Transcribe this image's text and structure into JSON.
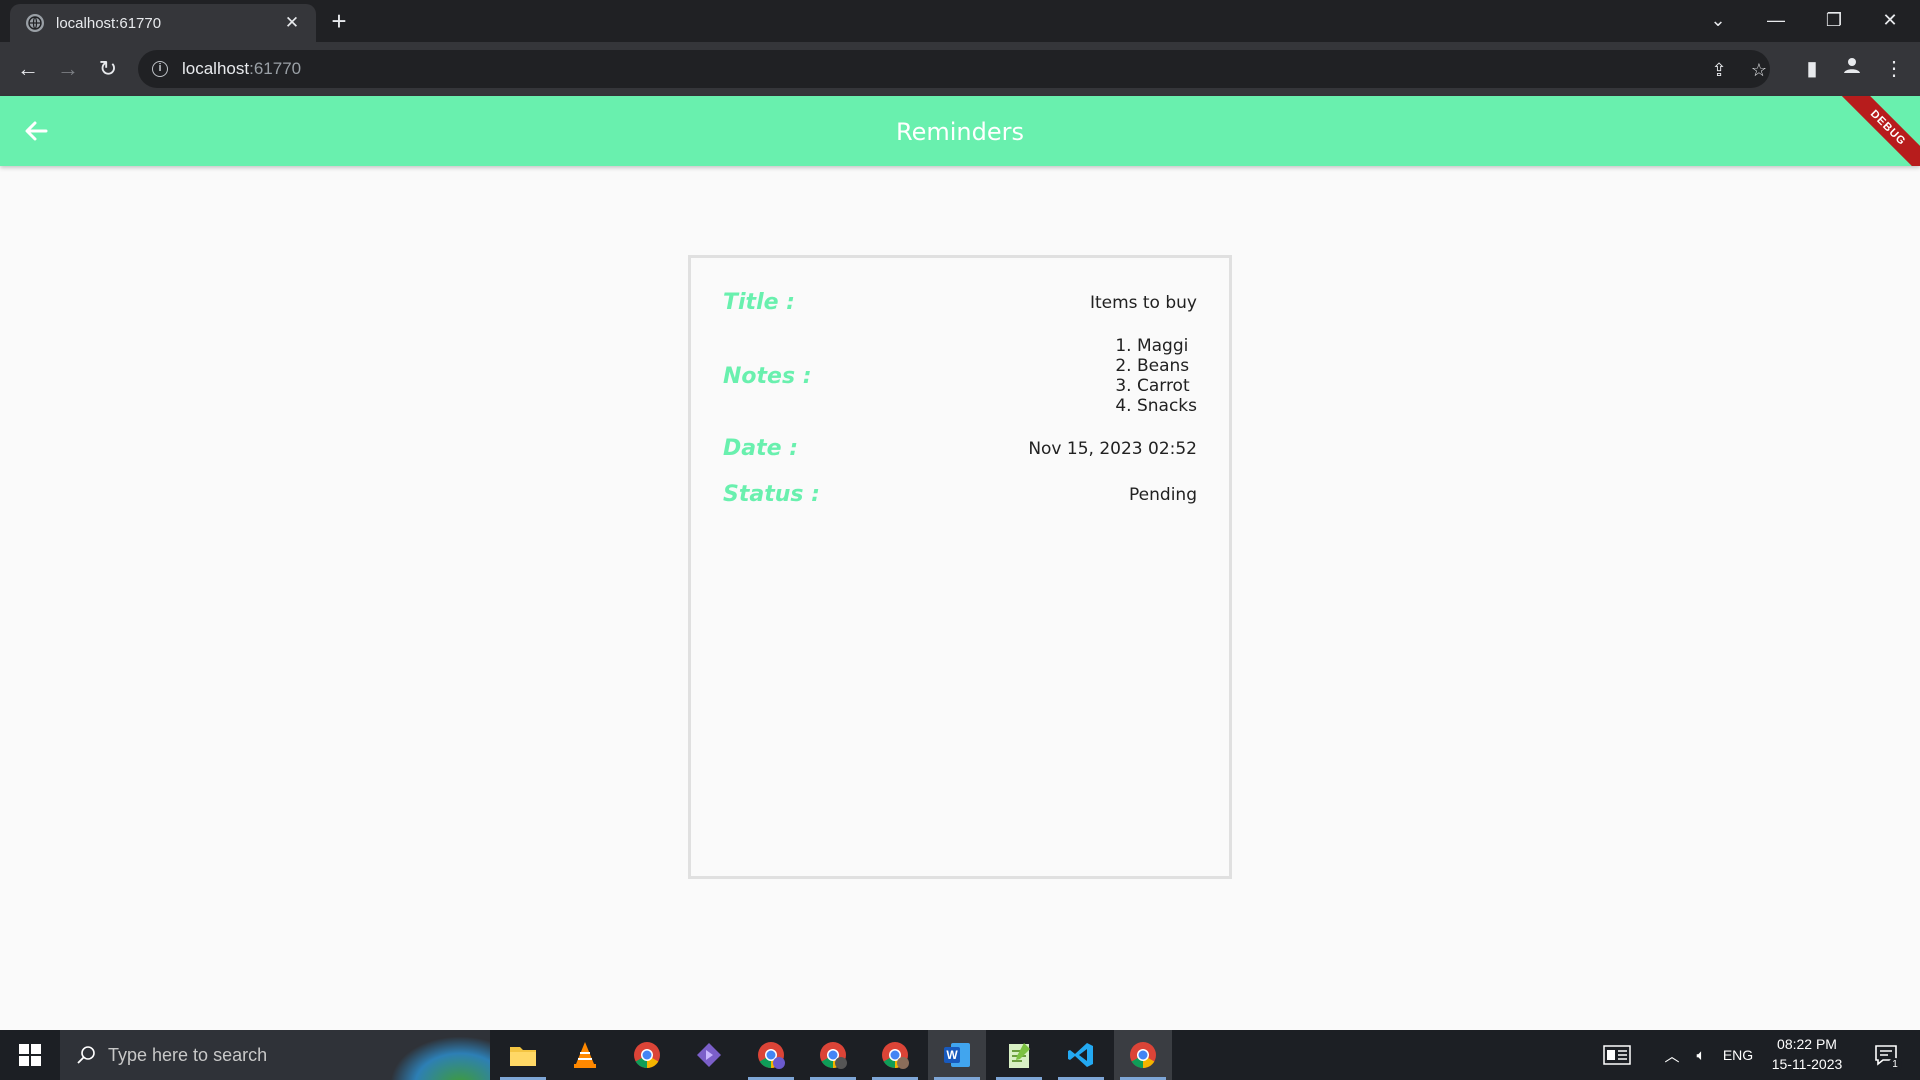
{
  "browser": {
    "tab_title": "localhost:61770",
    "url_host": "localhost",
    "url_port": ":61770"
  },
  "app": {
    "title": "Reminders",
    "debug_banner": "DEBUG"
  },
  "reminder": {
    "title_label": "Title :",
    "title_value": "Items to buy",
    "notes_label": "Notes :",
    "notes": [
      "1. Maggi",
      "2. Beans",
      "3. Carrot",
      "4. Snacks"
    ],
    "date_label": "Date :",
    "date_value": "Nov 15, 2023 02:52",
    "status_label": "Status :",
    "status_value": "Pending"
  },
  "taskbar": {
    "search_placeholder": "Type here to search",
    "language": "ENG",
    "time": "08:22 PM",
    "date": "15-11-2023",
    "notification_count": "1"
  },
  "colors": {
    "appbar": "#69f0ae",
    "label": "#69f0ae"
  }
}
